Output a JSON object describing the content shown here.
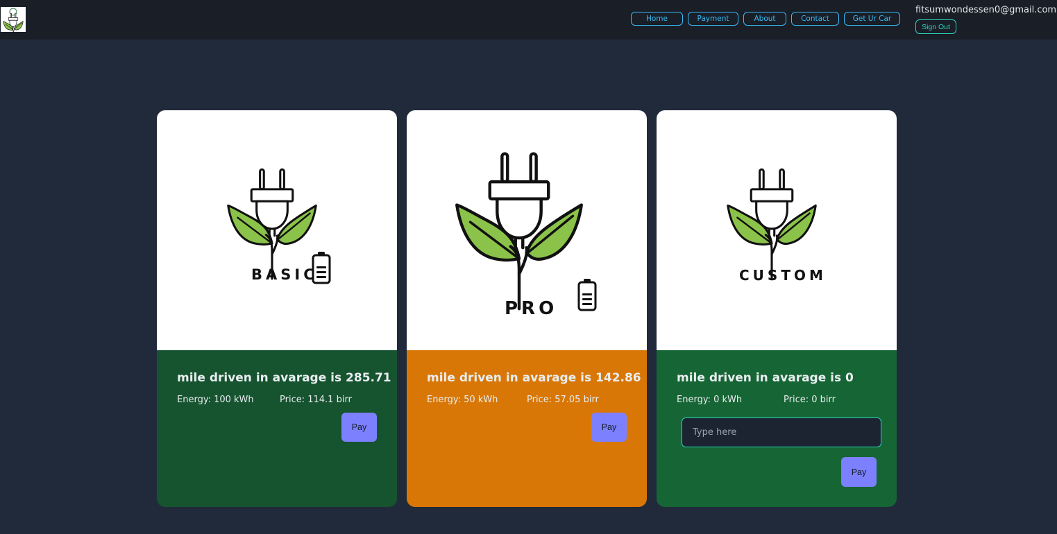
{
  "nav": {
    "links": [
      {
        "label": "Home"
      },
      {
        "label": "Payment"
      },
      {
        "label": "About"
      },
      {
        "label": "Contact"
      },
      {
        "label": "Get Ur Car"
      }
    ],
    "user_email": "fitsumwondessen0@gmail.com",
    "sign_out_label": "Sign Out"
  },
  "plans": [
    {
      "name": "BASIC",
      "mile_text": "mile driven in avarage is 285.71",
      "energy_text": "Energy: 100 kWh",
      "price_text": "Price: 114.1 birr",
      "pay_label": "Pay",
      "color": "#16532f",
      "icon": "plug-leaf-battery-icon"
    },
    {
      "name": "PRO",
      "mile_text": "mile driven in avarage is 142.86",
      "energy_text": "Energy: 50 kWh",
      "price_text": "Price: 57.05 birr",
      "pay_label": "Pay",
      "color": "#d97706",
      "icon": "plug-leaf-battery-icon"
    },
    {
      "name": "CUSTOM",
      "mile_text": "mile driven in avarage is 0",
      "energy_text": "Energy: 0 kWh",
      "price_text": "Price: 0 birr",
      "input_placeholder": "Type here",
      "pay_label": "Pay",
      "color": "#166534",
      "icon": "plug-leaf-icon"
    }
  ],
  "colors": {
    "page_bg": "#212a3b",
    "navbar_bg": "#191e27",
    "nav_accent": "#38bdf8",
    "signout_accent": "#2dd4bf",
    "pay_button": "#7c80ff",
    "leaf_green": "#8bc34a"
  }
}
